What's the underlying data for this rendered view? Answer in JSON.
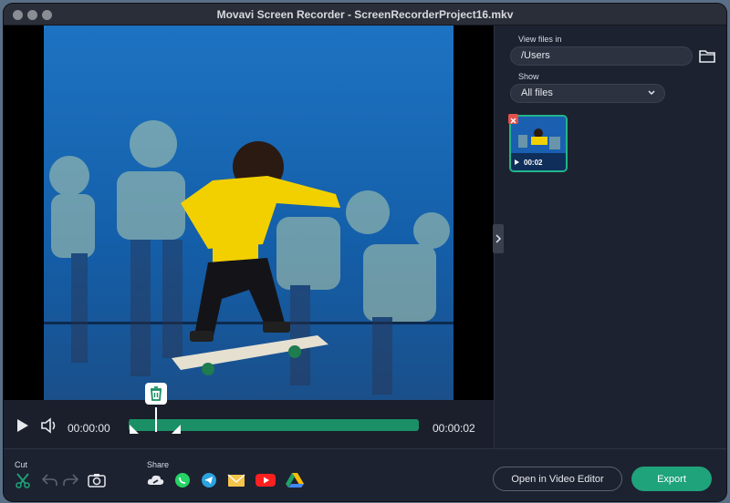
{
  "window": {
    "title": "Movavi Screen Recorder - ScreenRecorderProject16.mkv"
  },
  "player": {
    "current_time": "00:00:00",
    "duration": "00:00:02",
    "progress": 0.1
  },
  "toolbar": {
    "cut_label": "Cut",
    "share_label": "Share"
  },
  "share_icons": [
    "cloud-link-icon",
    "whatsapp-icon",
    "telegram-icon",
    "email-icon",
    "youtube-icon",
    "google-drive-icon"
  ],
  "actions": {
    "open_editor_label": "Open in Video Editor",
    "export_label": "Export"
  },
  "sidebar": {
    "view_files_label": "View files in",
    "path_value": "/Users",
    "show_label": "Show",
    "filter_value": "All files",
    "files": [
      {
        "duration": "00:02"
      }
    ]
  },
  "colors": {
    "accent": "#1fa37a",
    "track": "#1b8f66",
    "selection": "#21b58a",
    "background": "#1d2230"
  }
}
